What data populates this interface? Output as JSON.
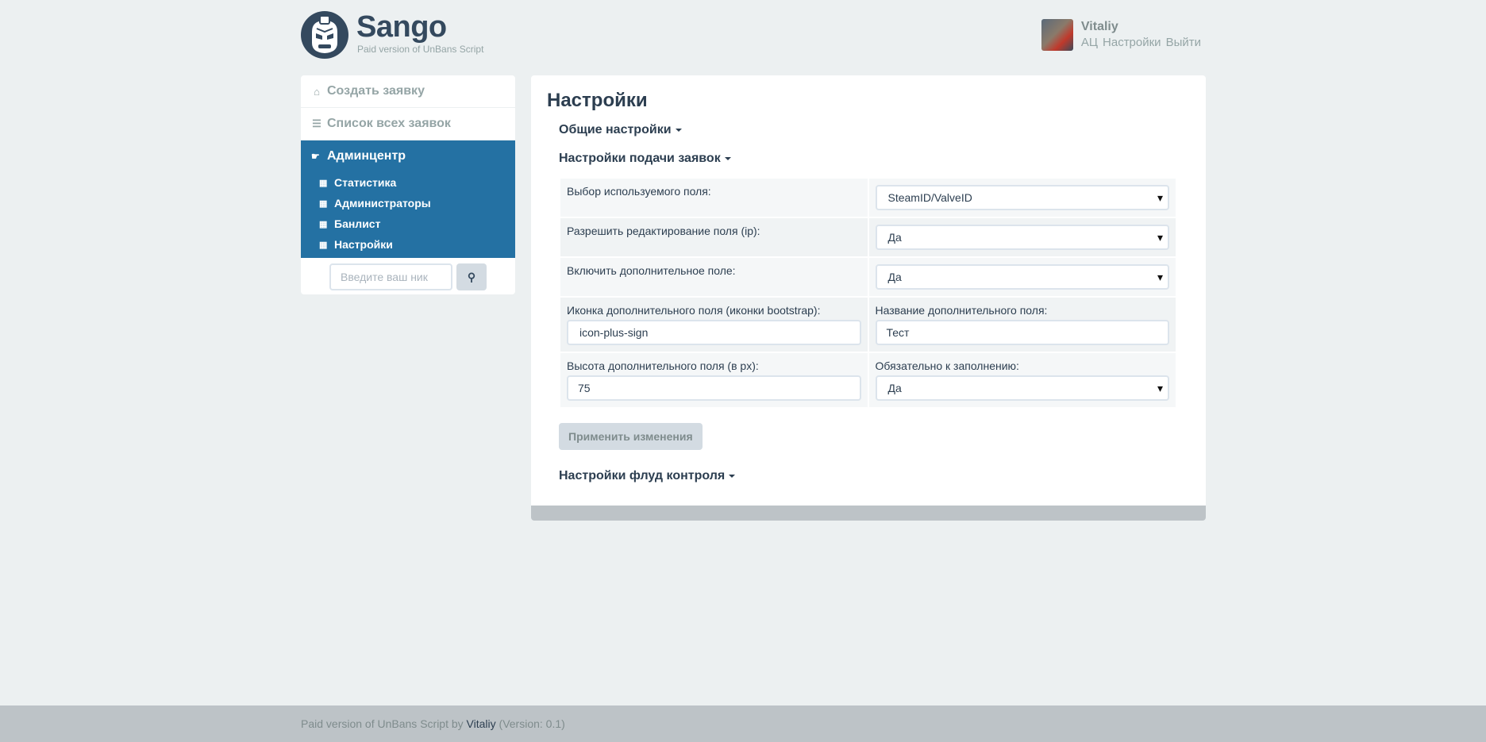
{
  "header": {
    "brand": "Sango",
    "subtitle": "Paid version of UnBans Script",
    "user": {
      "name": "Vitaliy",
      "links": [
        "АЦ",
        "Настройки",
        "Выйти"
      ]
    }
  },
  "sidebar": {
    "items": [
      {
        "label": "Создать заявку",
        "icon": "home-icon"
      },
      {
        "label": "Список всех заявок",
        "icon": "list-icon"
      }
    ],
    "active": {
      "label": "Админцентр",
      "icon": "hand-icon",
      "subitems": [
        "Статистика",
        "Администраторы",
        "Банлист",
        "Настройки"
      ]
    },
    "search": {
      "placeholder": "Введите ваш ник",
      "button_icon": "search-icon"
    }
  },
  "main": {
    "title": "Настройки",
    "sections": {
      "general": "Общие настройки",
      "requests": "Настройки подачи заявок",
      "flood": "Настройки флуд контроля"
    },
    "form": {
      "field_choice": {
        "label": "Выбор используемого поля:",
        "value": "SteamID/ValveID"
      },
      "allow_edit": {
        "label": "Разрешить редактирование поля (ip):",
        "value": "Да"
      },
      "extra_field": {
        "label": "Включить дополнительное поле:",
        "value": "Да"
      },
      "extra_icon": {
        "label": "Иконка дополнительного поля (иконки bootstrap):",
        "value": "icon-plus-sign"
      },
      "extra_name": {
        "label": "Название дополнительного поля:",
        "value": "Тест"
      },
      "extra_height": {
        "label": "Высота дополнительного поля (в px):",
        "value": "75"
      },
      "required": {
        "label": "Обязательно к заполнению:",
        "value": "Да"
      }
    },
    "apply_label": "Применить изменения"
  },
  "footer": {
    "prefix": "Paid version of UnBans Script by",
    "author": "Vitaliy",
    "version": "(Version: 0.1)"
  },
  "colors": {
    "background": "#ecf0f1",
    "active_nav": "#2471a3",
    "text_dark": "#2c3e50",
    "muted": "#95a5a6",
    "footer": "#bdc3c7"
  }
}
